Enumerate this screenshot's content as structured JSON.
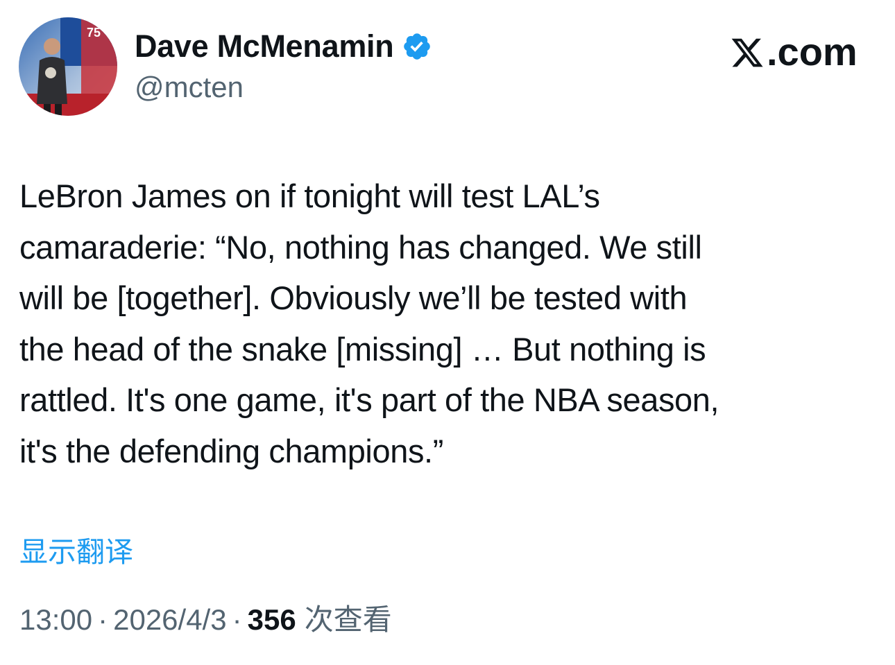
{
  "author": {
    "display_name": "Dave McMenamin",
    "handle": "@mcten",
    "verified": true,
    "avatar_icon": "profile-photo"
  },
  "brand": {
    "label": ".com",
    "icon": "x-logo-icon"
  },
  "tweet": {
    "text": "LeBron James on if tonight will test LAL’s\ncamaraderie: “No, nothing has changed. We still\nwill be [together]. Obviously we’ll be tested with\nthe head of the snake [missing] … But nothing is\nrattled. It's one game, it's part of the NBA season,\nit's the defending champions.”"
  },
  "translate_label": "显示翻译",
  "meta": {
    "time": "13:00",
    "separator": "·",
    "date": "2026/4/3",
    "views_count": "356",
    "views_label": "次查看"
  },
  "colors": {
    "link": "#1d9bf0",
    "secondary_text": "#536471",
    "primary_text": "#0f1419",
    "verified": "#1d9bf0"
  }
}
